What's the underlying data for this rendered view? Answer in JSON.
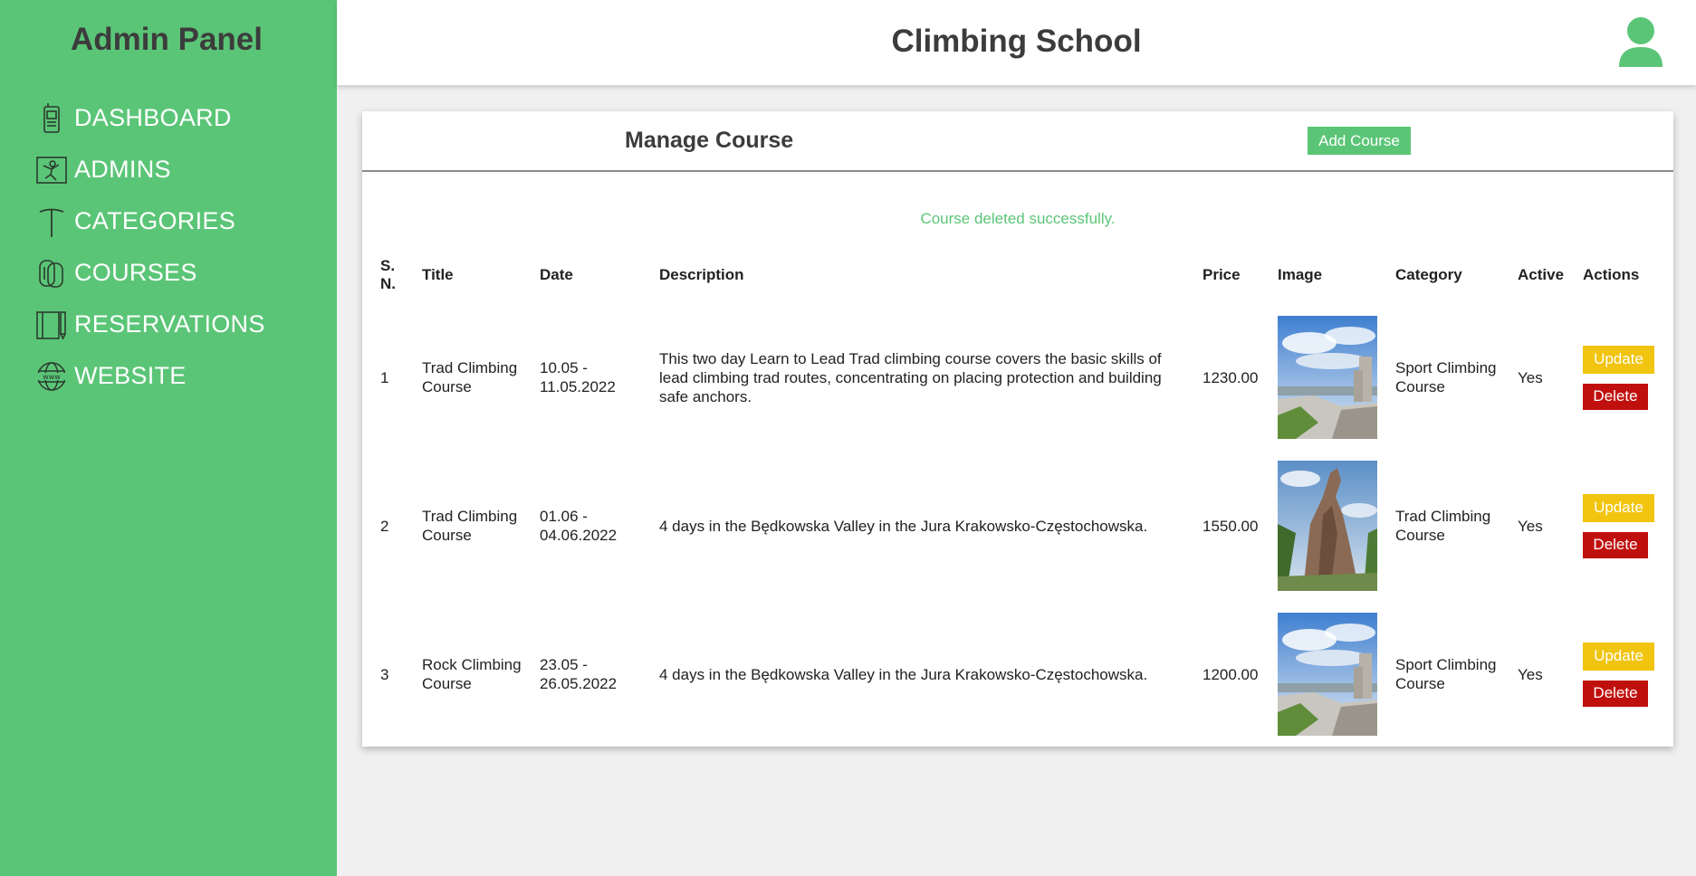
{
  "sidebar": {
    "title": "Admin Panel",
    "items": [
      {
        "label": "DASHBOARD",
        "icon": "phone-device-icon"
      },
      {
        "label": "ADMINS",
        "icon": "climber-icon"
      },
      {
        "label": "CATEGORIES",
        "icon": "ice-axe-icon"
      },
      {
        "label": "COURSES",
        "icon": "carabiner-icon"
      },
      {
        "label": "RESERVATIONS",
        "icon": "notebook-icon"
      },
      {
        "label": "WEBSITE",
        "icon": "globe-www-icon"
      }
    ]
  },
  "header": {
    "title": "Climbing School",
    "avatar_icon": "user-avatar-icon"
  },
  "main": {
    "title": "Manage Course",
    "add_button": "Add Course",
    "message": "Course deleted successfully.",
    "columns": [
      "S. N.",
      "Title",
      "Date",
      "Description",
      "Price",
      "Image",
      "Category",
      "Active",
      "Actions"
    ],
    "rows": [
      {
        "sn": "1",
        "title": "Trad Climbing Course",
        "date": "10.05 - 11.05.2022",
        "description": "This two day Learn to Lead Trad climbing course covers the basic skills of lead climbing trad routes, concentrating on placing protection and building safe anchors.",
        "price": "1230.00",
        "image": "castle-landscape",
        "category": "Sport Climbing Course",
        "active": "Yes",
        "update": "Update",
        "delete": "Delete"
      },
      {
        "sn": "2",
        "title": "Trad Climbing Course",
        "date": "01.06 - 04.06.2022",
        "description": "4 days in the Będkowska Valley in the Jura Krakowsko-Częstochowska.",
        "price": "1550.00",
        "image": "rock-spire",
        "category": "Trad Climbing Course",
        "active": "Yes",
        "update": "Update",
        "delete": "Delete"
      },
      {
        "sn": "3",
        "title": "Rock Climbing Course",
        "date": "23.05 - 26.05.2022",
        "description": "4 days in the Będkowska Valley in the Jura Krakowsko-Częstochowska.",
        "price": "1200.00",
        "image": "castle-landscape",
        "category": "Sport Climbing Course",
        "active": "Yes",
        "update": "Update",
        "delete": "Delete"
      }
    ]
  },
  "colors": {
    "accent": "#5bc577",
    "update": "#f1c40f",
    "delete": "#c0100e"
  }
}
